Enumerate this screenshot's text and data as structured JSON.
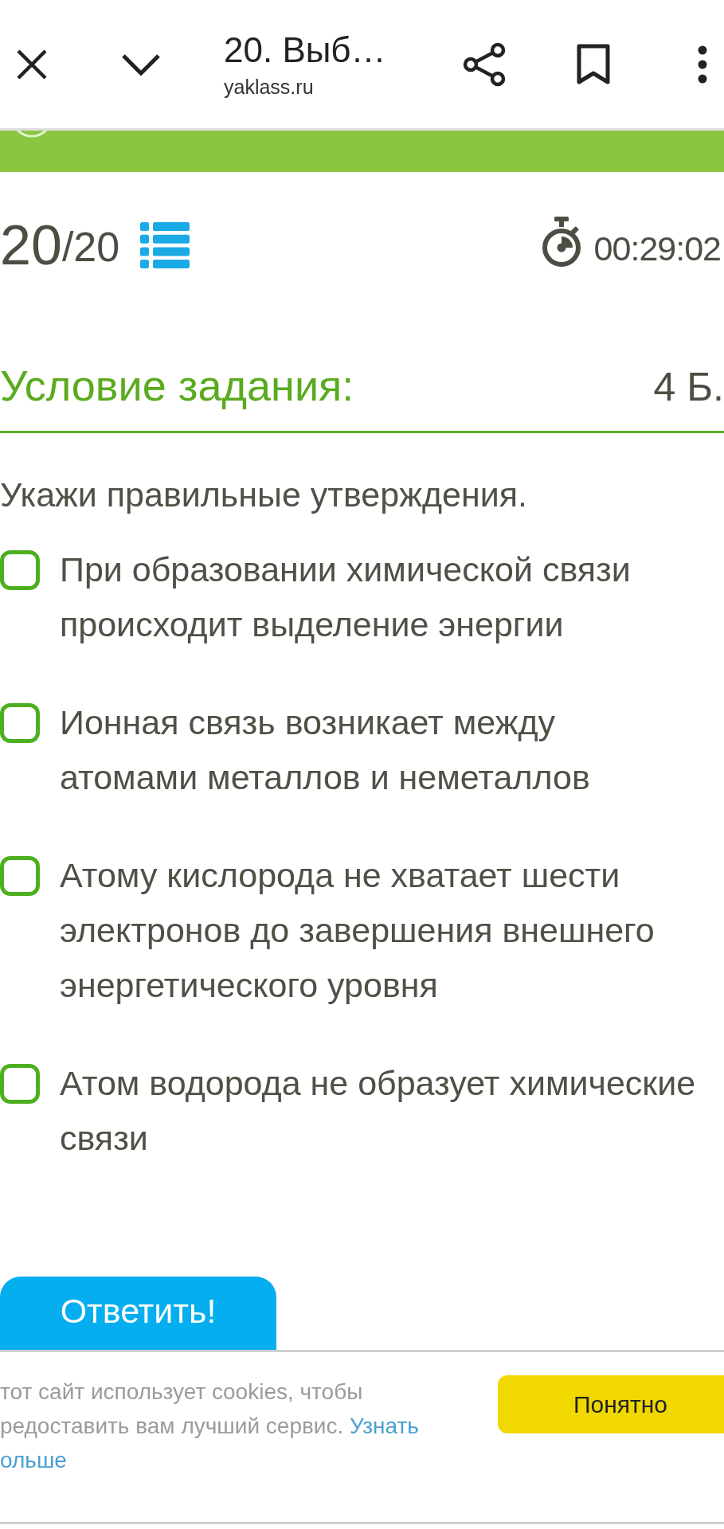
{
  "top_bar": {
    "title": "20. Выб…",
    "subtitle": "yaklass.ru"
  },
  "progress": {
    "current": "20",
    "total": "/20",
    "timer": "00:29:02"
  },
  "task": {
    "heading": "Условие задания:",
    "points": "4 Б.",
    "question": "Укажи правильные утверждения.",
    "options": [
      {
        "text": "При образовании химической связи происходит выделение энергии",
        "checked": false
      },
      {
        "text": "Ионная связь возникает между атомами металлов и неметаллов",
        "checked": false
      },
      {
        "text": "Атому кислорода не хватает шести электронов до завершения внешнего энергетического уровня",
        "checked": false
      },
      {
        "text": "Атом водорода не образует химические связи",
        "checked": false
      }
    ],
    "submit": "Ответить!"
  },
  "cookie_banner": {
    "lines": [
      {
        "text": "тот сайт использует cookies, чтобы"
      },
      {
        "text": "редоставить вам лучший сервис.",
        "link": "Узнать"
      },
      {
        "link": "ольше"
      }
    ],
    "button": "Понятно"
  }
}
